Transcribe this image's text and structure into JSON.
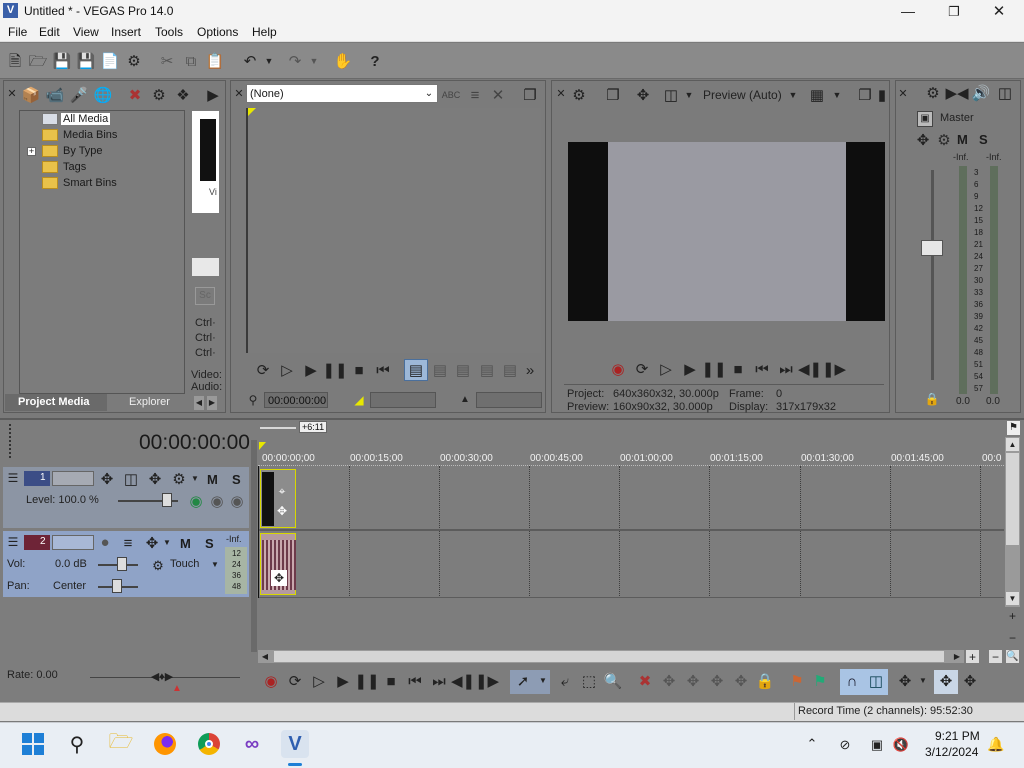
{
  "window": {
    "title": "Untitled * - VEGAS Pro 14.0"
  },
  "menu": [
    "File",
    "Edit",
    "View",
    "Insert",
    "Tools",
    "Options",
    "Help"
  ],
  "media": {
    "tree": [
      "All Media",
      "Media Bins",
      "By Type",
      "Tags",
      "Smart Bins"
    ],
    "expander": "+",
    "thumb_caption": "Vi",
    "shortcuts": [
      "Ctrl·",
      "Ctrl·",
      "Ctrl·"
    ],
    "info": [
      "Video:",
      "Audio:"
    ],
    "tabs": {
      "project_media": "Project Media",
      "explorer": "Explorer"
    }
  },
  "trimmer": {
    "dropdown": "(None)",
    "timecode": "00:00:00:00"
  },
  "preview": {
    "mode": "Preview (Auto)",
    "project_label": "Project:",
    "project_value": "640x360x32, 30.000p",
    "frame_label": "Frame:",
    "frame_value": "0",
    "preview_label": "Preview:",
    "preview_value": "160x90x32, 30.000p",
    "display_label": "Display:",
    "display_value": "317x179x32"
  },
  "master": {
    "title": "Master",
    "m": "M",
    "s": "S",
    "peak_left": "-Inf.",
    "peak_right": "-Inf.",
    "scale": [
      "3",
      "6",
      "9",
      "12",
      "15",
      "18",
      "21",
      "24",
      "27",
      "30",
      "33",
      "36",
      "39",
      "42",
      "45",
      "48",
      "51",
      "54",
      "57"
    ],
    "bottom_left": "0.0",
    "bottom_right": "0.0"
  },
  "timeline": {
    "timecode": "00:00:00:00",
    "marker": "+6:11",
    "ruler": [
      "00:00:00;00",
      "00:00:15;00",
      "00:00:30;00",
      "00:00:45;00",
      "00:01:00;00",
      "00:01:15;00",
      "00:01:30;00",
      "00:01:45;00",
      "00:0"
    ],
    "rate": "Rate: 0.00",
    "record_time": "Record Time (2 channels): 95:52:30"
  },
  "track1": {
    "number": "1",
    "level": "Level: 100.0 %",
    "m": "M",
    "s": "S"
  },
  "track2": {
    "number": "2",
    "vol_label": "Vol:",
    "vol_value": "0.0 dB",
    "pan_label": "Pan:",
    "pan_value": "Center",
    "mode": "Touch",
    "m": "M",
    "s": "S",
    "peak": "-Inf.",
    "scale": [
      "12",
      "24",
      "36",
      "48"
    ]
  },
  "clock": {
    "time": "9:21 PM",
    "date": "3/12/2024"
  },
  "colors": {
    "accent": "#e8e800",
    "timeline_bg": "#7d7d7d",
    "taskbar": "#e9eef4"
  }
}
